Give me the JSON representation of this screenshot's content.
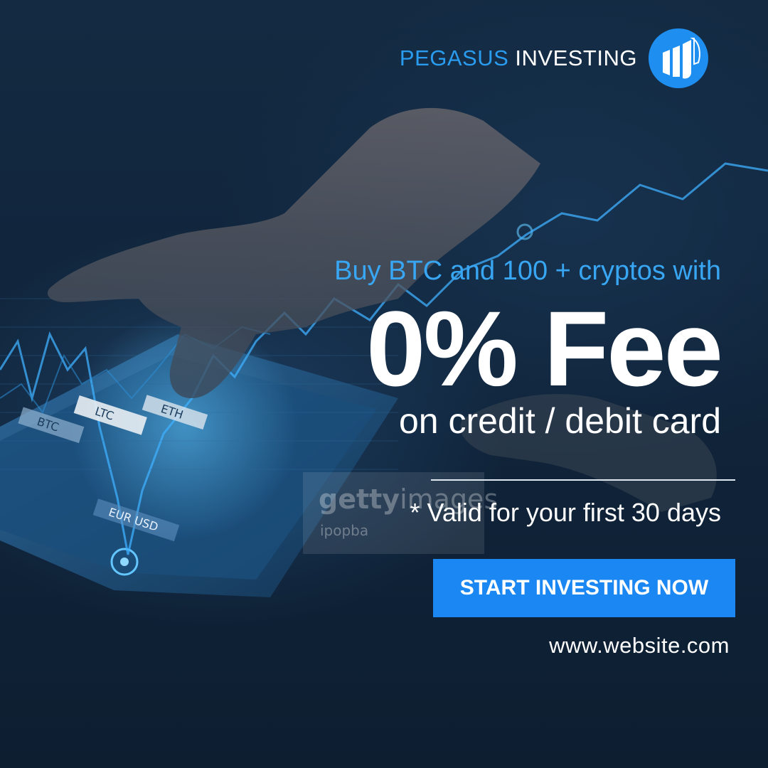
{
  "brand": {
    "name_part1": "PEGASUS",
    "name_part2": "INVESTING",
    "logo_icon": "pegasus-bar-chart-logo-icon",
    "accent_color": "#2a9cf0"
  },
  "promo": {
    "headline": "Buy BTC and 100 + cryptos with",
    "offer": "0% Fee",
    "offer_detail": "on credit / debit card",
    "note": "* Valid for your first 30 days"
  },
  "cta": {
    "label": "START INVESTING NOW",
    "color": "#1a87f2"
  },
  "footer": {
    "website": "www.website.com"
  },
  "watermark": {
    "brand_bold": "getty",
    "brand_light": "images",
    "credit": "ipopba"
  },
  "background": {
    "description_icon": "hand-touching-tablet-chart-image",
    "tablet_labels": [
      "BTC",
      "LTC",
      "ETH",
      "USD",
      "EUR USD"
    ]
  }
}
